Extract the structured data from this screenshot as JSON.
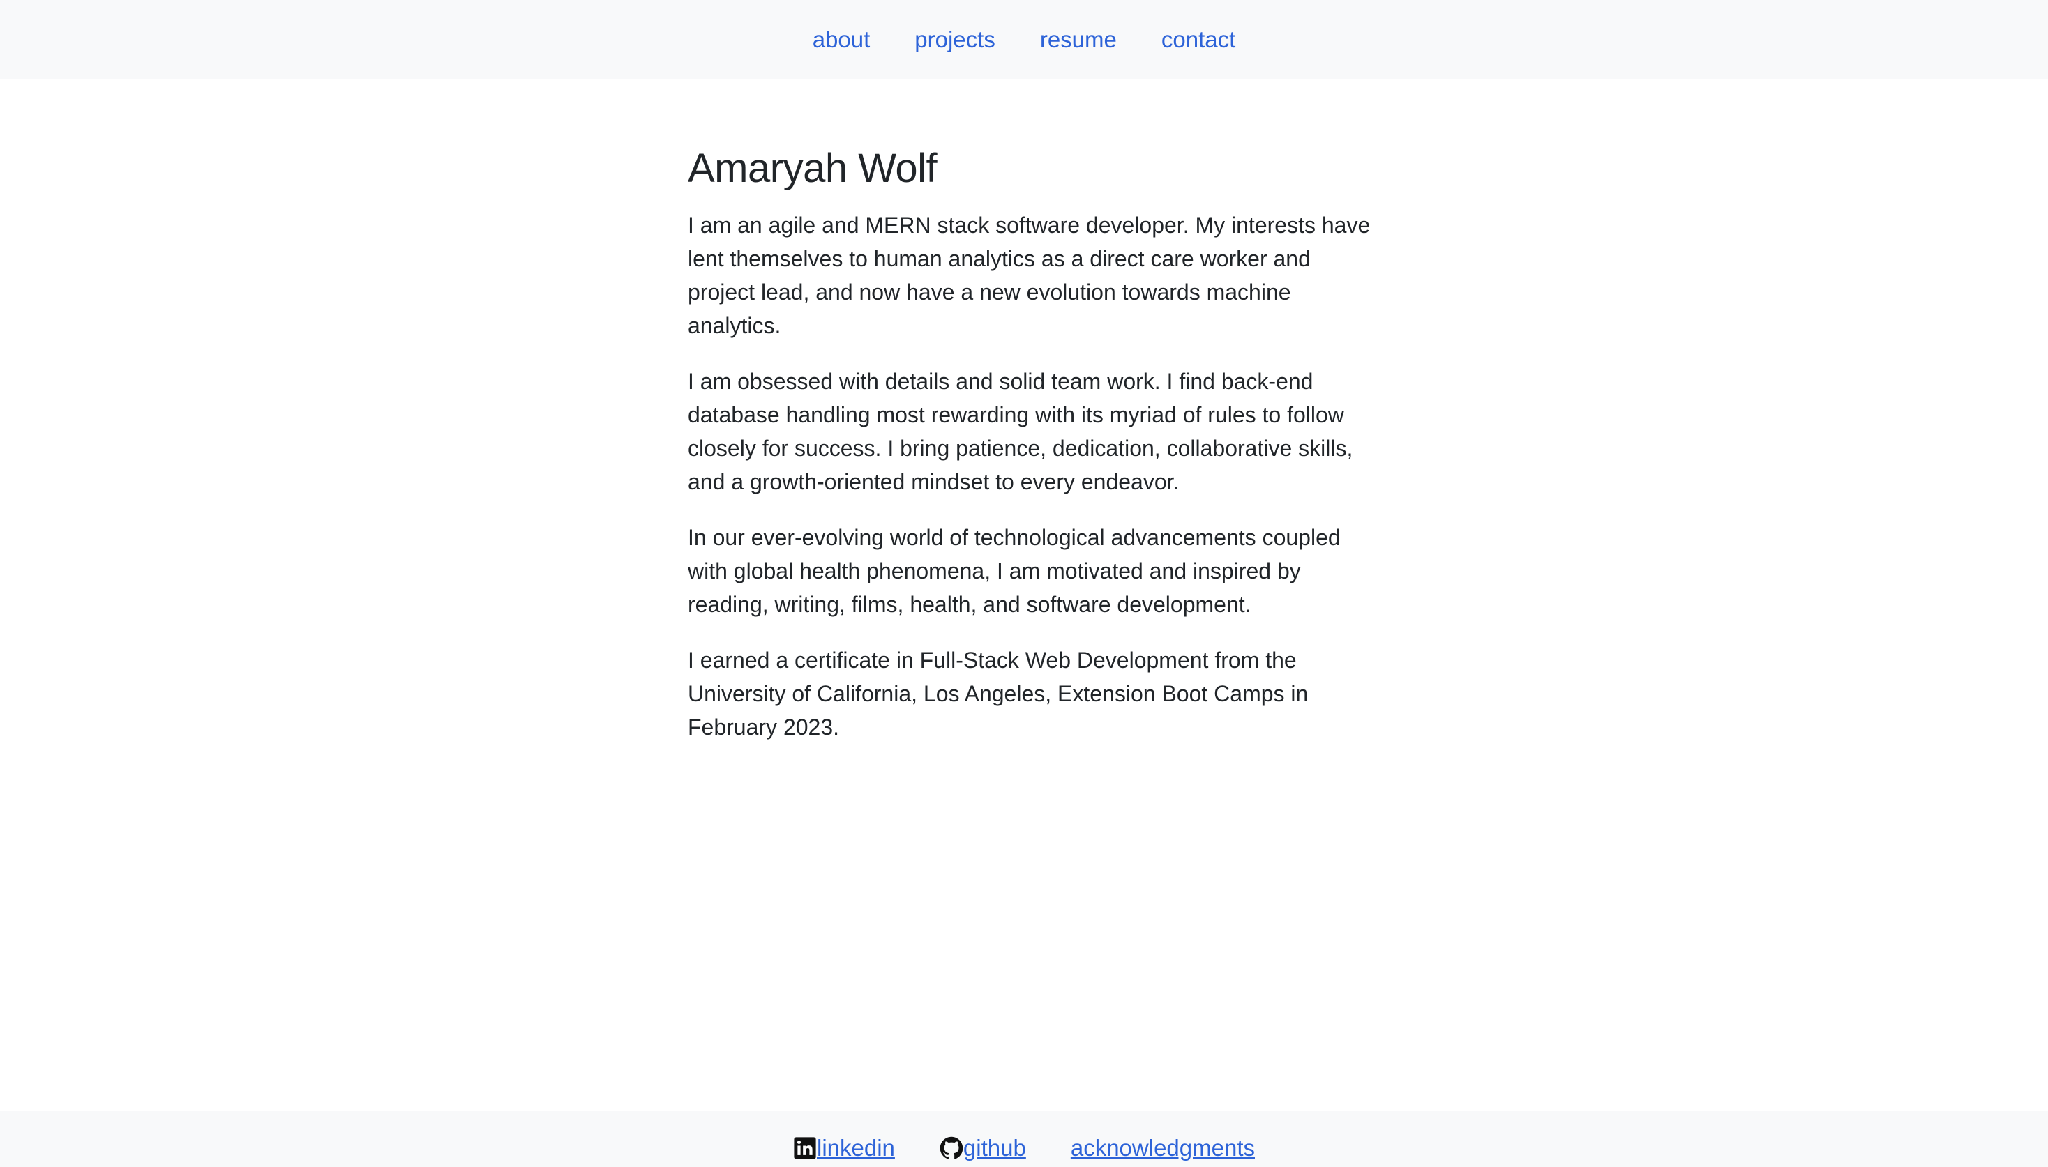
{
  "nav": {
    "items": [
      {
        "label": "about"
      },
      {
        "label": "projects"
      },
      {
        "label": "resume"
      },
      {
        "label": "contact"
      }
    ]
  },
  "main": {
    "name": "Amaryah Wolf",
    "paragraphs": [
      "I am an agile and MERN stack software developer. My interests have lent themselves to human analytics as a direct care worker and project lead, and now have a new evolution towards machine analytics.",
      "I am obsessed with details and solid team work. I find back-end database handling most rewarding with its myriad of rules to follow closely for success. I bring patience, dedication, collaborative skills, and a growth-oriented mindset to every endeavor.",
      "In our ever-evolving world of technological advancements coupled with global health phenomena, I am motivated and inspired by reading, writing, films, health, and software development.",
      "I earned a certificate in Full-Stack Web Development from the University of California, Los Angeles, Extension Boot Camps in February 2023."
    ]
  },
  "footer": {
    "linkedin_label": "linkedin",
    "github_label": "github",
    "acknowledgments_label": "acknowledgments"
  },
  "icons": {
    "linkedin": "linkedin-icon",
    "github": "github-icon"
  },
  "colors": {
    "link": "#2d63d8",
    "bar_background": "#f8f9fa",
    "text": "#212529"
  }
}
